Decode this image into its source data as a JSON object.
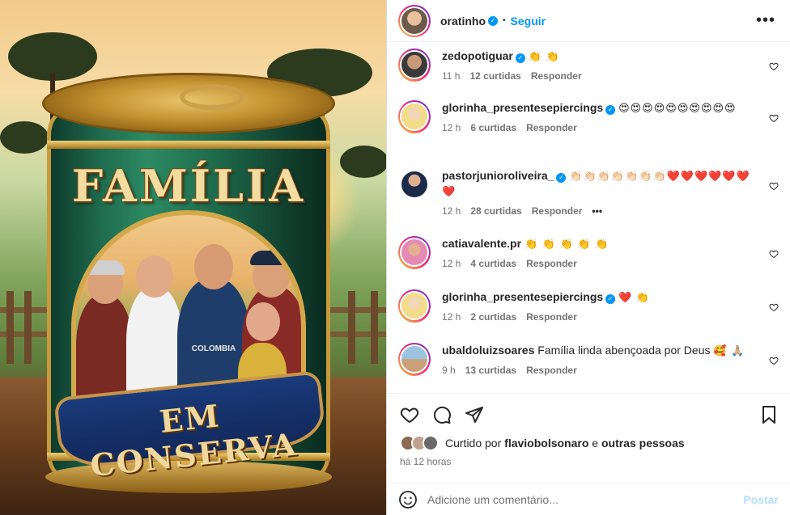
{
  "post": {
    "author": "oratinho",
    "follow_label": "Seguir",
    "dot": "•",
    "more_label": "•••"
  },
  "image": {
    "title_top": "FAMÍLIA",
    "title_bottom": "EM CONSERVA",
    "shirt_text": "COLOMBIA"
  },
  "comments": [
    {
      "user": "zedopotiguar",
      "verified": true,
      "text": "",
      "emojis": "👏 👏",
      "time": "11 h",
      "likes": "12 curtidas",
      "reply": "Responder"
    },
    {
      "user": "glorinha_presentesepiercings",
      "verified": true,
      "text": "",
      "emojis": "😍😍😍😍😍😍😍😍😍😍",
      "time": "12 h",
      "likes": "6 curtidas",
      "reply": "Responder"
    },
    {
      "user": "pastorjunioroliveira_",
      "verified": true,
      "text": "",
      "emojis": "👏🏻👏🏻👏🏻👏🏻👏🏻👏🏻👏🏻❤️❤️❤️❤️❤️❤️❤️",
      "time": "12 h",
      "likes": "28 curtidas",
      "reply": "Responder",
      "extra": "•••"
    },
    {
      "user": "catiavalente.pr",
      "verified": false,
      "text": "",
      "emojis": "👏 👏 👏 👏 👏",
      "time": "12 h",
      "likes": "4 curtidas",
      "reply": "Responder"
    },
    {
      "user": "glorinha_presentesepiercings",
      "verified": true,
      "text": "",
      "emojis": "❤️ 👏",
      "time": "12 h",
      "likes": "2 curtidas",
      "reply": "Responder"
    },
    {
      "user": "ubaldoluizsoares",
      "verified": false,
      "text": "Família linda abençoada por Deus",
      "emojis": "🥰 🙏🏼",
      "time": "9 h",
      "likes": "13 curtidas",
      "reply": "Responder"
    }
  ],
  "liked_by": {
    "prefix": "Curtido por",
    "user": "flaviobolsonaro",
    "joiner": "e",
    "others": "outras pessoas"
  },
  "timestamp": "há 12 horas",
  "composer": {
    "placeholder": "Adicione um comentário...",
    "post_label": "Postar"
  },
  "colors": {
    "accent": "#0095f6",
    "post_disabled": "#b2dffc",
    "muted": "#737373"
  }
}
